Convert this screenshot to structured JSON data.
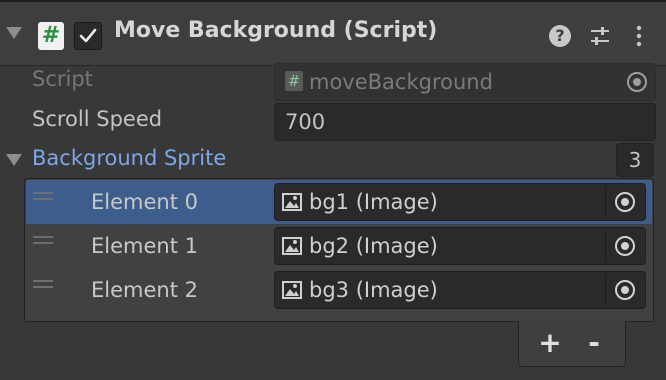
{
  "component": {
    "title": "Move Background (Script)",
    "icon": "script-icon",
    "enabled": true
  },
  "script_field": {
    "label": "Script",
    "value": "moveBackground"
  },
  "scroll_speed": {
    "label": "Scroll Speed",
    "value": "700"
  },
  "background_sprite": {
    "label": "Background Sprite",
    "size": "3",
    "elements": [
      {
        "label": "Element 0",
        "value": "bg1 (Image)",
        "selected": true
      },
      {
        "label": "Element 1",
        "value": "bg2 (Image)",
        "selected": false
      },
      {
        "label": "Element 2",
        "value": "bg3 (Image)",
        "selected": false
      }
    ],
    "add_label": "+",
    "remove_label": "-"
  },
  "colors": {
    "selection": "#3d5d8d",
    "foldout_label": "#7ea7e8",
    "script_icon_green": "#2f8f3f"
  }
}
